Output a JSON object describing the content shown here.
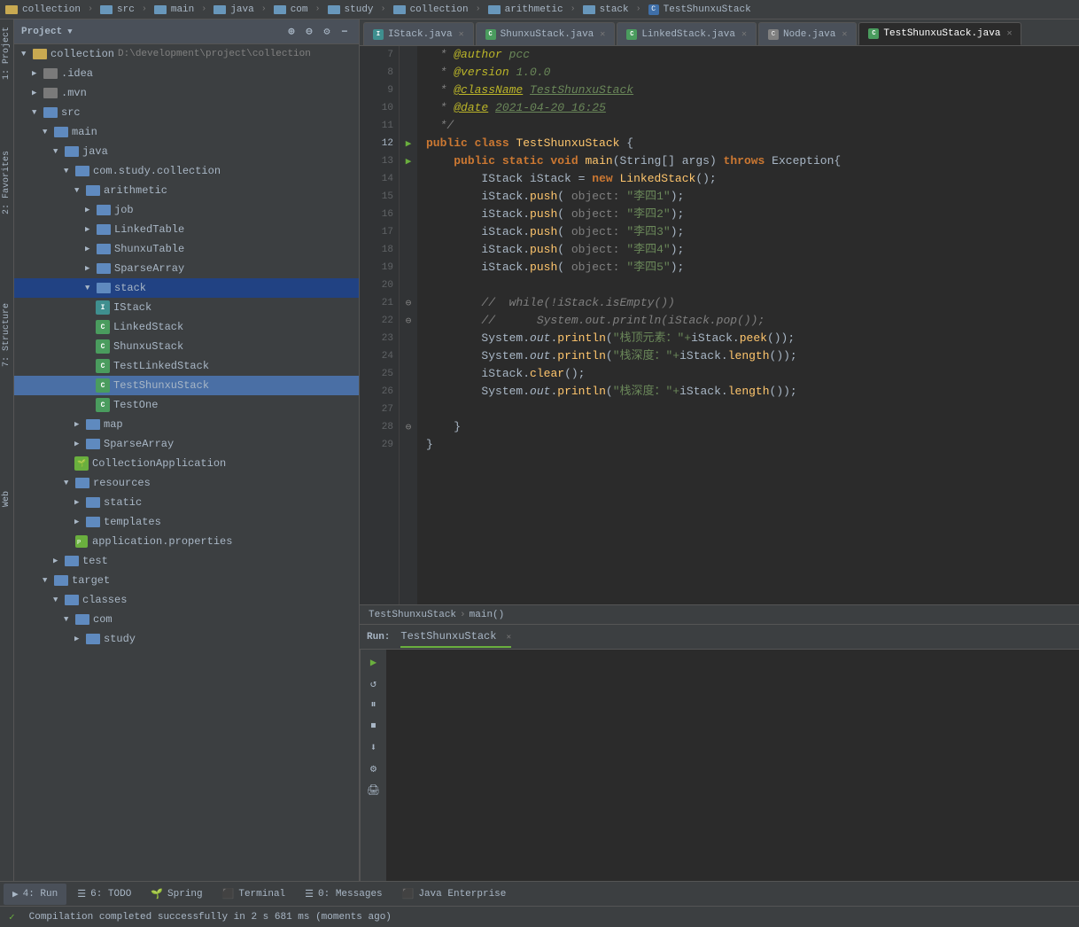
{
  "toolbar": {
    "breadcrumbs": [
      {
        "label": "collection",
        "type": "folder",
        "icon": "folder-yellow"
      },
      {
        "label": "src",
        "type": "folder",
        "icon": "folder-blue"
      },
      {
        "label": "main",
        "type": "folder",
        "icon": "folder-blue"
      },
      {
        "label": "java",
        "type": "folder",
        "icon": "folder-blue"
      },
      {
        "label": "com",
        "type": "folder",
        "icon": "folder-blue"
      },
      {
        "label": "study",
        "type": "folder",
        "icon": "folder-blue"
      },
      {
        "label": "collection",
        "type": "folder",
        "icon": "folder-blue"
      },
      {
        "label": "arithmetic",
        "type": "folder",
        "icon": "folder-blue"
      },
      {
        "label": "stack",
        "type": "folder",
        "icon": "folder-blue"
      },
      {
        "label": "TestShunxuStack",
        "type": "class",
        "icon": "class"
      }
    ]
  },
  "project_panel": {
    "title": "Project",
    "root": {
      "label": "collection",
      "path": "D:\\development\\project\\collection"
    }
  },
  "tabs": [
    {
      "label": "IStack.java",
      "type": "interface",
      "active": false
    },
    {
      "label": "ShunxuStack.java",
      "type": "class",
      "active": false
    },
    {
      "label": "LinkedStack.java",
      "type": "class",
      "active": false
    },
    {
      "label": "Node.java",
      "type": "class",
      "active": false
    },
    {
      "label": "TestShunxuStack.java",
      "type": "class",
      "active": true
    }
  ],
  "tree_items": [
    {
      "id": "collection-root",
      "label": "collection",
      "path": "D:\\development\\project\\collection",
      "indent": 1,
      "expanded": true,
      "type": "project"
    },
    {
      "id": "idea",
      "label": ".idea",
      "indent": 2,
      "expanded": false,
      "type": "folder-dark"
    },
    {
      "id": "mvn",
      "label": ".mvn",
      "indent": 2,
      "expanded": false,
      "type": "folder-dark"
    },
    {
      "id": "src",
      "label": "src",
      "indent": 2,
      "expanded": true,
      "type": "folder-blue"
    },
    {
      "id": "main",
      "label": "main",
      "indent": 3,
      "expanded": true,
      "type": "folder-blue"
    },
    {
      "id": "java",
      "label": "java",
      "indent": 4,
      "expanded": true,
      "type": "folder-blue"
    },
    {
      "id": "com-study-collection",
      "label": "com.study.collection",
      "indent": 5,
      "expanded": true,
      "type": "folder-blue"
    },
    {
      "id": "arithmetic",
      "label": "arithmetic",
      "indent": 6,
      "expanded": true,
      "type": "folder-blue"
    },
    {
      "id": "job",
      "label": "job",
      "indent": 7,
      "expanded": false,
      "type": "folder-blue"
    },
    {
      "id": "linkedtable",
      "label": "LinkedTable",
      "indent": 7,
      "expanded": false,
      "type": "folder-blue"
    },
    {
      "id": "shunxutable",
      "label": "ShunxuTable",
      "indent": 7,
      "expanded": false,
      "type": "folder-blue"
    },
    {
      "id": "sparsearray-sub",
      "label": "SparseArray",
      "indent": 7,
      "expanded": false,
      "type": "folder-blue"
    },
    {
      "id": "stack",
      "label": "stack",
      "indent": 7,
      "expanded": true,
      "type": "folder-blue",
      "selected": true
    },
    {
      "id": "istack",
      "label": "IStack",
      "indent": 8,
      "type": "interface"
    },
    {
      "id": "linkedstack",
      "label": "LinkedStack",
      "indent": 8,
      "type": "class-green"
    },
    {
      "id": "shunxustack",
      "label": "ShunxuStack",
      "indent": 8,
      "type": "class-green"
    },
    {
      "id": "testlinkedstack",
      "label": "TestLinkedStack",
      "indent": 8,
      "type": "class-green"
    },
    {
      "id": "testshunxustack",
      "label": "TestShunxuStack",
      "indent": 8,
      "type": "class-green",
      "active": true
    },
    {
      "id": "testone",
      "label": "TestOne",
      "indent": 8,
      "type": "class-green"
    },
    {
      "id": "map",
      "label": "map",
      "indent": 6,
      "expanded": false,
      "type": "folder-blue"
    },
    {
      "id": "sparsearray",
      "label": "SparseArray",
      "indent": 6,
      "expanded": false,
      "type": "folder-blue"
    },
    {
      "id": "collectionapp",
      "label": "CollectionApplication",
      "indent": 6,
      "type": "class-spring"
    },
    {
      "id": "resources",
      "label": "resources",
      "indent": 5,
      "expanded": true,
      "type": "folder-blue"
    },
    {
      "id": "static",
      "label": "static",
      "indent": 6,
      "expanded": false,
      "type": "folder-blue"
    },
    {
      "id": "templates",
      "label": "templates",
      "indent": 6,
      "expanded": false,
      "type": "folder-blue"
    },
    {
      "id": "appprops",
      "label": "application.properties",
      "indent": 6,
      "type": "file-props"
    },
    {
      "id": "test",
      "label": "test",
      "indent": 4,
      "expanded": false,
      "type": "folder-blue"
    },
    {
      "id": "target",
      "label": "target",
      "indent": 3,
      "expanded": true,
      "type": "folder-blue"
    },
    {
      "id": "classes",
      "label": "classes",
      "indent": 4,
      "expanded": true,
      "type": "folder-blue"
    },
    {
      "id": "com-target",
      "label": "com",
      "indent": 5,
      "expanded": true,
      "type": "folder-blue"
    },
    {
      "id": "study-target",
      "label": "study",
      "indent": 6,
      "expanded": false,
      "type": "folder-blue"
    }
  ],
  "code_lines": [
    {
      "num": 7,
      "gutter": "",
      "content": " * <span class='ann'>@author</span> <span class='ann-val'>pcc</span>"
    },
    {
      "num": 8,
      "gutter": "",
      "content": " * <span class='ann'>@version</span> <span class='ann-val'>1.0.0</span>"
    },
    {
      "num": 9,
      "gutter": "",
      "content": " * <span class='ann'>@className</span> <span class='ann-val'>TestShunxuStack</span>"
    },
    {
      "num": 10,
      "gutter": "",
      "content": " * <span class='ann'>@date</span> <span class='ann-val'>2021-04-20 16:25</span>"
    },
    {
      "num": 11,
      "gutter": "",
      "content": " <span class='cmt'>*/</span>"
    },
    {
      "num": 12,
      "gutter": "▶",
      "content": "<span class='kw'>public class</span> <span class='cls-name'>TestShunxuStack</span> {"
    },
    {
      "num": 13,
      "gutter": "▶",
      "content": "    <span class='kw'>public static void</span> <span class='method'>main</span>(<span class='cls'>String</span>[] <span class='param'>args</span>) <span class='kw'>throws</span> <span class='cls'>Exception</span>{"
    },
    {
      "num": 14,
      "gutter": "",
      "content": "        <span class='cls'>IStack</span> <span class='param'>iStack</span> = <span class='kw'>new</span> <span class='cls-name'>LinkedStack</span>();"
    },
    {
      "num": 15,
      "gutter": "",
      "content": "        <span class='param'>iStack</span>.<span class='method'>push</span>( object: <span class='str'>\"李四1\"</span>);"
    },
    {
      "num": 16,
      "gutter": "",
      "content": "        <span class='param'>iStack</span>.<span class='method'>push</span>( object: <span class='str'>\"李四2\"</span>);"
    },
    {
      "num": 17,
      "gutter": "",
      "content": "        <span class='param'>iStack</span>.<span class='method'>push</span>( object: <span class='str'>\"李四3\"</span>);"
    },
    {
      "num": 18,
      "gutter": "",
      "content": "        <span class='param'>iStack</span>.<span class='method'>push</span>( object: <span class='str'>\"李四4\"</span>);"
    },
    {
      "num": 19,
      "gutter": "",
      "content": "        <span class='param'>iStack</span>.<span class='method'>push</span>( object: <span class='str'>\"李四5\"</span>);"
    },
    {
      "num": 20,
      "gutter": "",
      "content": ""
    },
    {
      "num": 21,
      "gutter": "⊖",
      "content": "        <span class='cmt'>// while(!iStack.isEmpty())</span>"
    },
    {
      "num": 22,
      "gutter": "⊖",
      "content": "        <span class='cmt'>//     System.out.println(iStack.pop());</span>"
    },
    {
      "num": 23,
      "gutter": "",
      "content": "        <span class='cls'>System</span>.<span class='param'>out</span>.<span class='method'>println</span>(<span class='str'>\"栈顶元素：\"+</span><span class='param'>iStack</span>.<span class='method'>peek</span>());"
    },
    {
      "num": 24,
      "gutter": "",
      "content": "        <span class='cls'>System</span>.<span class='param'>out</span>.<span class='method'>println</span>(<span class='str'>\"栈深度：\"+</span><span class='param'>iStack</span>.<span class='method'>length</span>());"
    },
    {
      "num": 25,
      "gutter": "",
      "content": "        <span class='param'>iStack</span>.<span class='method'>clear</span>();"
    },
    {
      "num": 26,
      "gutter": "",
      "content": "        <span class='cls'>System</span>.<span class='param'>out</span>.<span class='method'>println</span>(<span class='str'>\"栈深度：\"+</span><span class='param'>iStack</span>.<span class='method'>length</span>());"
    },
    {
      "num": 27,
      "gutter": "",
      "content": ""
    },
    {
      "num": 28,
      "gutter": "⊖",
      "content": "    }"
    },
    {
      "num": 29,
      "gutter": "",
      "content": "}"
    }
  ],
  "breadcrumb": {
    "class": "TestShunxuStack",
    "method": "main()"
  },
  "run_panel": {
    "tab_label": "TestShunxuStack",
    "close_label": "✕"
  },
  "bottom_tabs": [
    {
      "label": "▶  4: Run",
      "icon": "run"
    },
    {
      "label": "☰  6: TODO",
      "icon": "todo"
    },
    {
      "label": "🌱 Spring",
      "icon": "spring"
    },
    {
      "label": "⬛ Terminal",
      "icon": "terminal"
    },
    {
      "label": "☰  0: Messages",
      "icon": "messages"
    },
    {
      "label": "⬛ Java Enterprise",
      "icon": "java-enterprise"
    }
  ],
  "status_bar": {
    "message": "Compilation completed successfully in 2 s 681 ms (moments ago)"
  },
  "side_panels": [
    {
      "label": "1: Project"
    },
    {
      "label": "2: Favorites"
    },
    {
      "label": "7: Structure"
    },
    {
      "label": "Web"
    }
  ]
}
